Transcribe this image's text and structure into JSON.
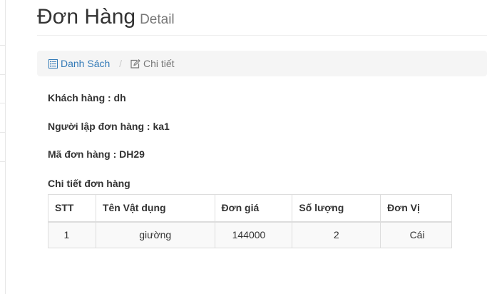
{
  "header": {
    "title": "Đơn Hàng",
    "subtitle": "Detail"
  },
  "breadcrumb": {
    "list_label": "Danh Sách",
    "list_icon": "list-icon",
    "separator": "/",
    "detail_label": "Chi tiết",
    "detail_icon": "edit-icon"
  },
  "info": {
    "customer": "Khách hàng : dh",
    "creator": "Người lập đơn hàng : ka1",
    "order_code": "Mã đơn hàng : DH29",
    "details_heading": "Chi tiết đơn hàng"
  },
  "table": {
    "headers": [
      "STT",
      "Tên Vật dụng",
      "Đơn giá",
      "Số lượng",
      "Đơn Vị"
    ],
    "rows": [
      [
        "1",
        "giường",
        "144000",
        "2",
        "Cái"
      ]
    ]
  },
  "colors": {
    "link": "#337ab7",
    "breadcrumb_bg": "#f5f5f5",
    "table_border": "#dddddd",
    "row_stripe": "#f9f9f9"
  }
}
